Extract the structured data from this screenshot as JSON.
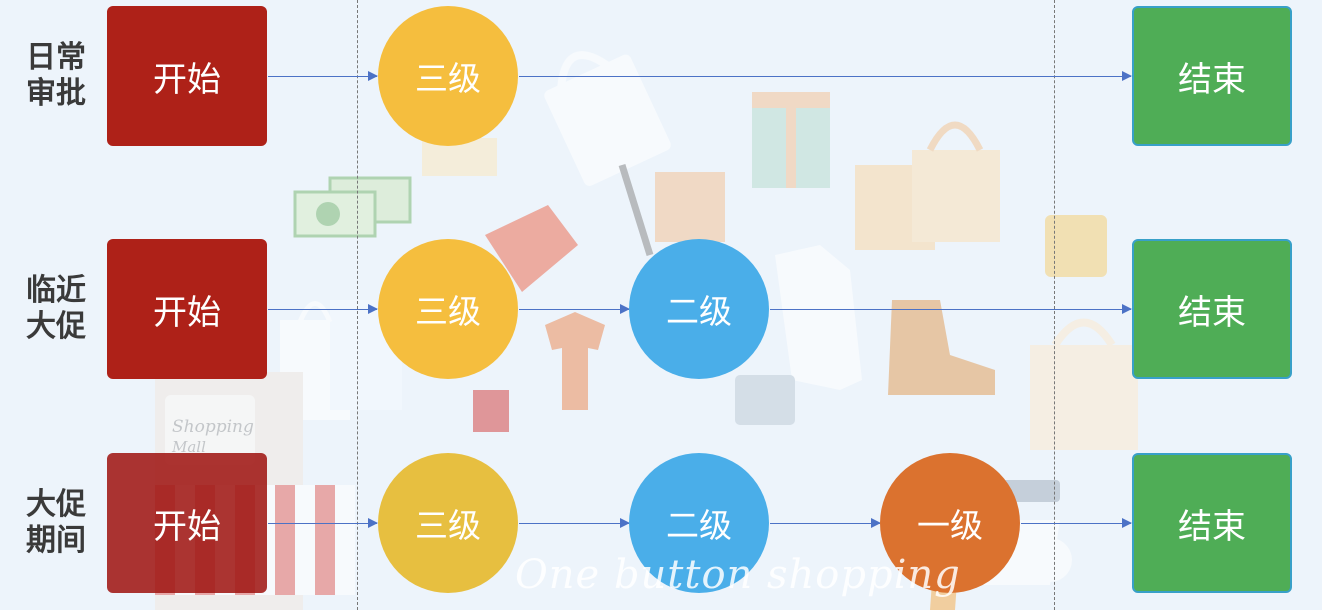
{
  "rows": [
    {
      "label": [
        "日常",
        "审批"
      ],
      "start": "开始",
      "levels": [
        "三级"
      ],
      "end": "结束"
    },
    {
      "label": [
        "临近",
        "大促"
      ],
      "start": "开始",
      "levels": [
        "三级",
        "二级"
      ],
      "end": "结束"
    },
    {
      "label": [
        "大促",
        "期间"
      ],
      "start": "开始",
      "levels": [
        "三级",
        "二级",
        "一级"
      ],
      "end": "结束"
    }
  ],
  "background": {
    "watermark": "One button shopping",
    "sign_text": "Shopping Mall"
  },
  "colors": {
    "start": "#ae2118",
    "level3": "#f5be3e",
    "level2": "#4aaee9",
    "level1": "#db722f",
    "end": "#4fad56",
    "arrow": "#4c72c6"
  }
}
